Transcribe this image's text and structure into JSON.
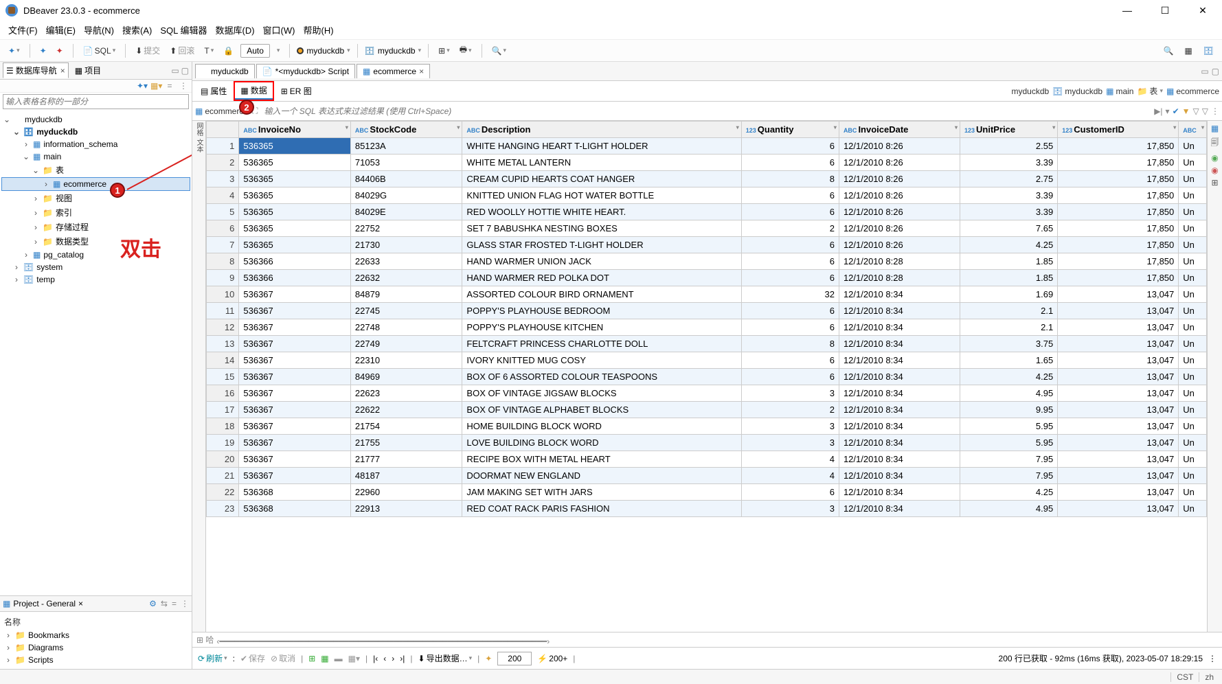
{
  "window": {
    "title": "DBeaver 23.0.3 - ecommerce"
  },
  "menu": [
    "文件(F)",
    "编辑(E)",
    "导航(N)",
    "搜索(A)",
    "SQL 编辑器",
    "数据库(D)",
    "窗口(W)",
    "帮助(H)"
  ],
  "toolbar": {
    "sql": "SQL",
    "commit": "提交",
    "rollback": "回滚",
    "auto": "Auto",
    "conn1": "myduckdb",
    "conn2": "myduckdb"
  },
  "nav": {
    "tab1": "数据库导航",
    "tab2": "项目",
    "filter_ph": "输入表格名称的一部分",
    "nodes": {
      "root": "myduckdb",
      "db": "myduckdb",
      "info": "information_schema",
      "main": "main",
      "tables": "表",
      "ecom": "ecommerce",
      "views": "视图",
      "idx": "索引",
      "proc": "存储过程",
      "types": "数据类型",
      "pg": "pg_catalog",
      "sys": "system",
      "temp": "temp"
    },
    "annot": "双击"
  },
  "project": {
    "header": "Project - General",
    "col": "名称",
    "items": [
      "Bookmarks",
      "Diagrams",
      "Scripts"
    ]
  },
  "editor": {
    "tabs": [
      "myduckdb",
      "*<myduckdb> Script",
      "ecommerce"
    ],
    "subtabs": {
      "prop": "属性",
      "data": "数据",
      "er": "ER 图"
    },
    "crumb": [
      "myduckdb",
      "myduckdb",
      "main",
      "表",
      "ecommerce"
    ],
    "filter_lbl": "ecommerce",
    "filter_ph": "输入一个 SQL 表达式来过滤结果 (使用 Ctrl+Space)"
  },
  "columns": [
    "InvoiceNo",
    "StockCode",
    "Description",
    "Quantity",
    "InvoiceDate",
    "UnitPrice",
    "CustomerID",
    ""
  ],
  "coltyp": [
    "ABC",
    "ABC",
    "ABC",
    "123",
    "ABC",
    "123",
    "123",
    "ABC"
  ],
  "rows": [
    [
      "536365",
      "85123A",
      "WHITE HANGING HEART T-LIGHT HOLDER",
      "6",
      "12/1/2010 8:26",
      "2.55",
      "17,850",
      "Un"
    ],
    [
      "536365",
      "71053",
      "WHITE METAL LANTERN",
      "6",
      "12/1/2010 8:26",
      "3.39",
      "17,850",
      "Un"
    ],
    [
      "536365",
      "84406B",
      "CREAM CUPID HEARTS COAT HANGER",
      "8",
      "12/1/2010 8:26",
      "2.75",
      "17,850",
      "Un"
    ],
    [
      "536365",
      "84029G",
      "KNITTED UNION FLAG HOT WATER BOTTLE",
      "6",
      "12/1/2010 8:26",
      "3.39",
      "17,850",
      "Un"
    ],
    [
      "536365",
      "84029E",
      "RED WOOLLY HOTTIE WHITE HEART.",
      "6",
      "12/1/2010 8:26",
      "3.39",
      "17,850",
      "Un"
    ],
    [
      "536365",
      "22752",
      "SET 7 BABUSHKA NESTING BOXES",
      "2",
      "12/1/2010 8:26",
      "7.65",
      "17,850",
      "Un"
    ],
    [
      "536365",
      "21730",
      "GLASS STAR FROSTED T-LIGHT HOLDER",
      "6",
      "12/1/2010 8:26",
      "4.25",
      "17,850",
      "Un"
    ],
    [
      "536366",
      "22633",
      "HAND WARMER UNION JACK",
      "6",
      "12/1/2010 8:28",
      "1.85",
      "17,850",
      "Un"
    ],
    [
      "536366",
      "22632",
      "HAND WARMER RED POLKA DOT",
      "6",
      "12/1/2010 8:28",
      "1.85",
      "17,850",
      "Un"
    ],
    [
      "536367",
      "84879",
      "ASSORTED COLOUR BIRD ORNAMENT",
      "32",
      "12/1/2010 8:34",
      "1.69",
      "13,047",
      "Un"
    ],
    [
      "536367",
      "22745",
      "POPPY'S PLAYHOUSE BEDROOM",
      "6",
      "12/1/2010 8:34",
      "2.1",
      "13,047",
      "Un"
    ],
    [
      "536367",
      "22748",
      "POPPY'S PLAYHOUSE KITCHEN",
      "6",
      "12/1/2010 8:34",
      "2.1",
      "13,047",
      "Un"
    ],
    [
      "536367",
      "22749",
      "FELTCRAFT PRINCESS CHARLOTTE DOLL",
      "8",
      "12/1/2010 8:34",
      "3.75",
      "13,047",
      "Un"
    ],
    [
      "536367",
      "22310",
      "IVORY KNITTED MUG COSY",
      "6",
      "12/1/2010 8:34",
      "1.65",
      "13,047",
      "Un"
    ],
    [
      "536367",
      "84969",
      "BOX OF 6 ASSORTED COLOUR TEASPOONS",
      "6",
      "12/1/2010 8:34",
      "4.25",
      "13,047",
      "Un"
    ],
    [
      "536367",
      "22623",
      "BOX OF VINTAGE JIGSAW BLOCKS",
      "3",
      "12/1/2010 8:34",
      "4.95",
      "13,047",
      "Un"
    ],
    [
      "536367",
      "22622",
      "BOX OF VINTAGE ALPHABET BLOCKS",
      "2",
      "12/1/2010 8:34",
      "9.95",
      "13,047",
      "Un"
    ],
    [
      "536367",
      "21754",
      "HOME BUILDING BLOCK WORD",
      "3",
      "12/1/2010 8:34",
      "5.95",
      "13,047",
      "Un"
    ],
    [
      "536367",
      "21755",
      "LOVE BUILDING BLOCK WORD",
      "3",
      "12/1/2010 8:34",
      "5.95",
      "13,047",
      "Un"
    ],
    [
      "536367",
      "21777",
      "RECIPE BOX WITH METAL HEART",
      "4",
      "12/1/2010 8:34",
      "7.95",
      "13,047",
      "Un"
    ],
    [
      "536367",
      "48187",
      "DOORMAT NEW ENGLAND",
      "4",
      "12/1/2010 8:34",
      "7.95",
      "13,047",
      "Un"
    ],
    [
      "536368",
      "22960",
      "JAM MAKING SET WITH JARS",
      "6",
      "12/1/2010 8:34",
      "4.25",
      "13,047",
      "Un"
    ],
    [
      "536368",
      "22913",
      "RED COAT RACK PARIS FASHION",
      "3",
      "12/1/2010 8:34",
      "4.95",
      "13,047",
      "Un"
    ]
  ],
  "status": {
    "refresh": "刷新",
    "save": "保存",
    "cancel": "取消",
    "export": "导出数据…",
    "pagesize": "200",
    "more": "200+",
    "info": "200 行已获取 - 92ms (16ms 获取), 2023-05-07 18:29:15"
  },
  "bottom": {
    "tz": "CST",
    "lang": "zh"
  }
}
